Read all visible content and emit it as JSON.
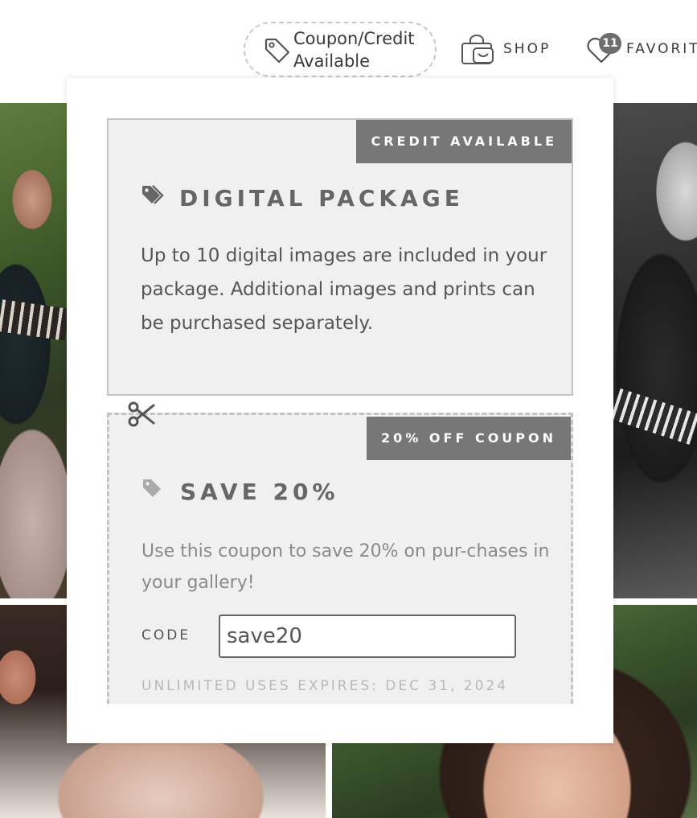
{
  "header": {
    "coupon_link": {
      "label_line1": "Coupon/Credit",
      "label_line2": "Available",
      "icon": "tag-icon"
    },
    "shop_link": {
      "label": "SHOP",
      "icon": "shopping-bag-icon"
    },
    "favorites_link": {
      "label": "FAVORITES",
      "count": "11",
      "icon": "heart-icon"
    }
  },
  "popup": {
    "credit_card": {
      "badge": "CREDIT AVAILABLE",
      "title": "DIGITAL PACKAGE",
      "title_icon": "tags-icon",
      "description": "Up to 10 digital images are included in your package. Additional images and prints can be purchased separately."
    },
    "coupon_card": {
      "badge": "20% OFF COUPON",
      "title": "SAVE 20%",
      "title_icon": "tag-icon",
      "description": "Use this coupon to save 20% on pur-chases in your gallery!",
      "code_label": "CODE",
      "code_value": "save20",
      "footer": "UNLIMITED USES EXPIRES: DEC 31, 2024",
      "cut_icon": "scissors-icon"
    }
  },
  "colors": {
    "badge_bg": "#777777",
    "card_bg": "#f0f0f0",
    "text_dark": "#3a3a3a"
  }
}
